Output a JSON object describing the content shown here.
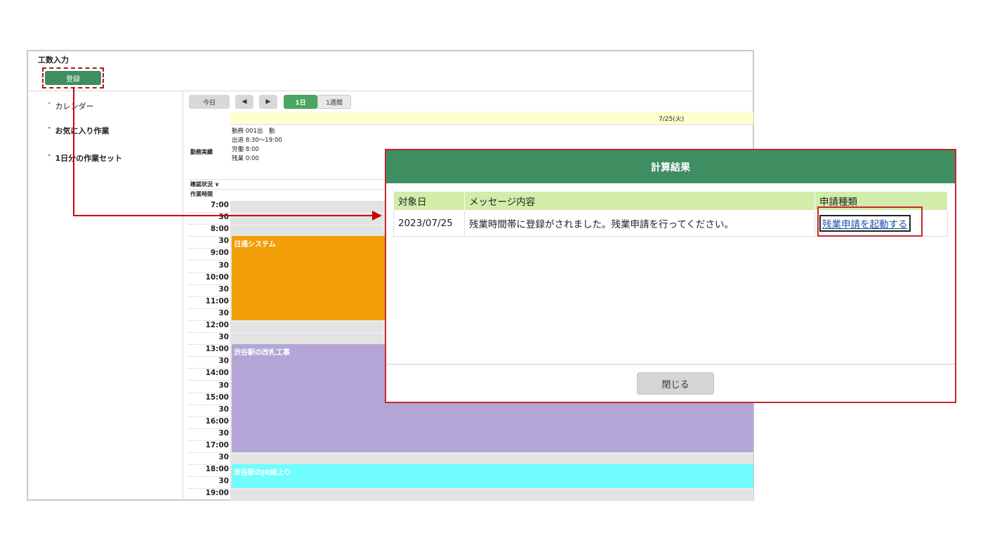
{
  "app": {
    "title": "工数入力",
    "register_label": "登録"
  },
  "sidebar": {
    "items": [
      {
        "chevron": "˅",
        "label": "カレンダー"
      },
      {
        "chevron": "˄",
        "label": "お気に入り作業"
      },
      {
        "chevron": "˄",
        "label": "1日分の作業セット"
      }
    ]
  },
  "toolbar": {
    "today": "今日",
    "prev": "◀",
    "next": "▶",
    "day": "1日",
    "week": "1週間"
  },
  "calendar": {
    "date": "7/25(火)",
    "kinmu_label": "勤務実績",
    "kinmu_lines": [
      "勤務 001出　勤",
      "出退 8:30〜19:00",
      "労働 8:00",
      "残業 0:00"
    ],
    "status_label": "確認状況 ∨",
    "work_time_label": "作業時間",
    "times": [
      "7:00",
      "30",
      "8:00",
      "30",
      "9:00",
      "30",
      "10:00",
      "30",
      "11:00",
      "30",
      "12:00",
      "30",
      "13:00",
      "30",
      "14:00",
      "30",
      "15:00",
      "30",
      "16:00",
      "30",
      "17:00",
      "30",
      "18:00",
      "30",
      "19:00"
    ],
    "blocks": [
      {
        "label": "日通システム",
        "color": "#f29e07"
      },
      {
        "label": "渋谷駅の改札工事",
        "color": "#b3a6d6"
      },
      {
        "label": "渋谷駅のJR線上り",
        "color": "#6ffdfd"
      }
    ]
  },
  "dialog": {
    "title": "計算結果",
    "headers": [
      "対象日",
      "メッセージ内容",
      "申請種類"
    ],
    "row": {
      "date": "2023/07/25",
      "message": "残業時間帯に登録がされました。残業申請を行ってください。",
      "link": "残業申請を起動する"
    },
    "close_label": "閉じる"
  },
  "colors": {
    "accent": "#3e8e62",
    "highlight": "#c9262d"
  }
}
